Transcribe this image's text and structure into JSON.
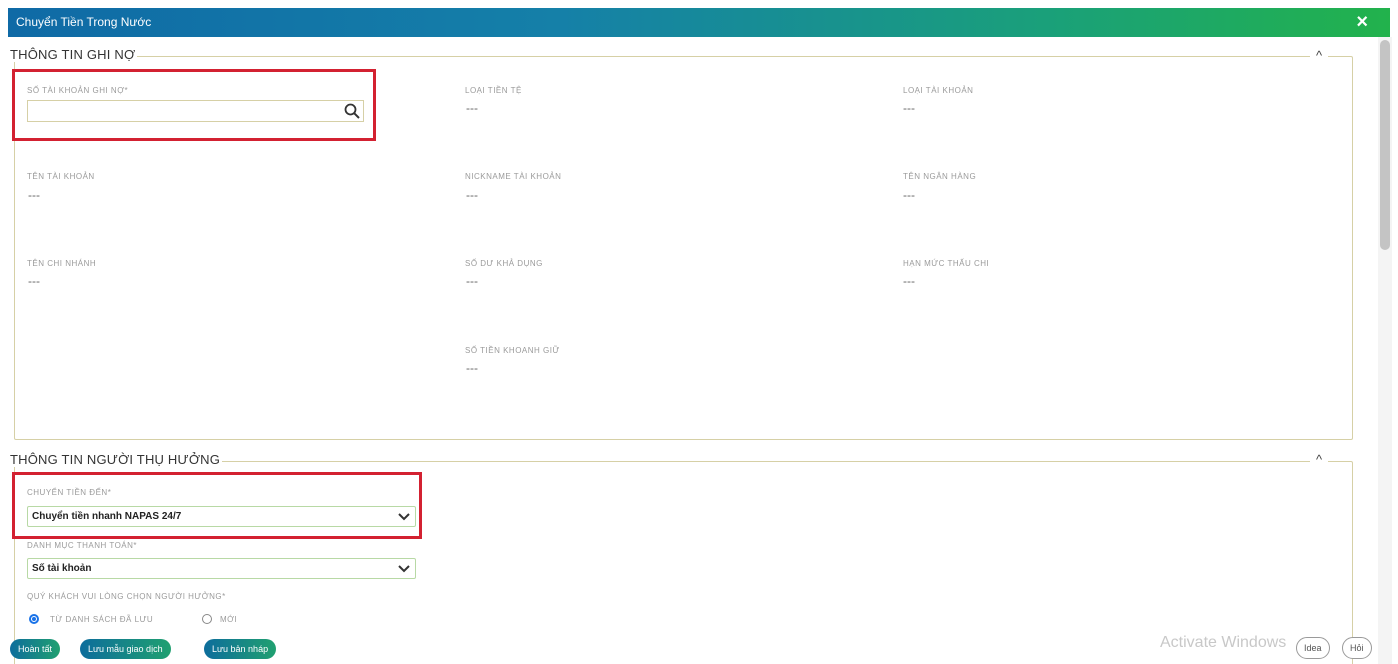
{
  "window": {
    "title": "Chuyển Tiền Trong Nước",
    "close_glyph": "×"
  },
  "debit_section": {
    "legend": "THÔNG TIN GHI NỢ",
    "collapse_glyph": "^",
    "account_number": {
      "label": "SỐ TÀI KHOẢN GHI NỢ*",
      "value": "",
      "placeholder": ""
    },
    "currency": {
      "label": "LOẠI TIỀN TỆ",
      "value": "---"
    },
    "account_type": {
      "label": "LOẠI TÀI KHOẢN",
      "value": "---"
    },
    "account_name": {
      "label": "TÊN TÀI KHOẢN",
      "value": "---"
    },
    "nickname": {
      "label": "NICKNAME TÀI KHOẢN",
      "value": "---"
    },
    "bank_name": {
      "label": "TÊN NGÂN HÀNG",
      "value": "---"
    },
    "branch_name": {
      "label": "TÊN CHI NHÁNH",
      "value": "---"
    },
    "available_balance": {
      "label": "SỐ DƯ KHẢ DỤNG",
      "value": "---"
    },
    "overdraft_limit": {
      "label": "HẠN MỨC THẤU CHI",
      "value": "---"
    },
    "held_amount": {
      "label": "SỐ TIỀN KHOANH GIỮ",
      "value": "---"
    }
  },
  "beneficiary_section": {
    "legend": "THÔNG TIN NGƯỜI THỤ HƯỞNG",
    "collapse_glyph": "^",
    "transfer_to": {
      "label": "CHUYỂN TIỀN ĐẾN*",
      "selected": "Chuyển tiền nhanh NAPAS 24/7"
    },
    "payment_category": {
      "label": "DANH MỤC THANH TOÁN*",
      "selected": "Số tài khoản"
    },
    "choose_beneficiary": {
      "label": "QUÝ KHÁCH VUI LÒNG CHỌN NGƯỜI HƯỞNG*",
      "options": [
        "TỪ DANH SÁCH ĐÃ LƯU",
        "MỚI"
      ],
      "selected_index": 0
    }
  },
  "actions": {
    "finish": "Hoàn tất",
    "save_template": "Lưu mẫu giao dịch",
    "save_draft": "Lưu bản nháp"
  },
  "overlay": {
    "watermark": "Activate Windows",
    "pill_1": "Idea",
    "pill_2": "Hỏi"
  }
}
